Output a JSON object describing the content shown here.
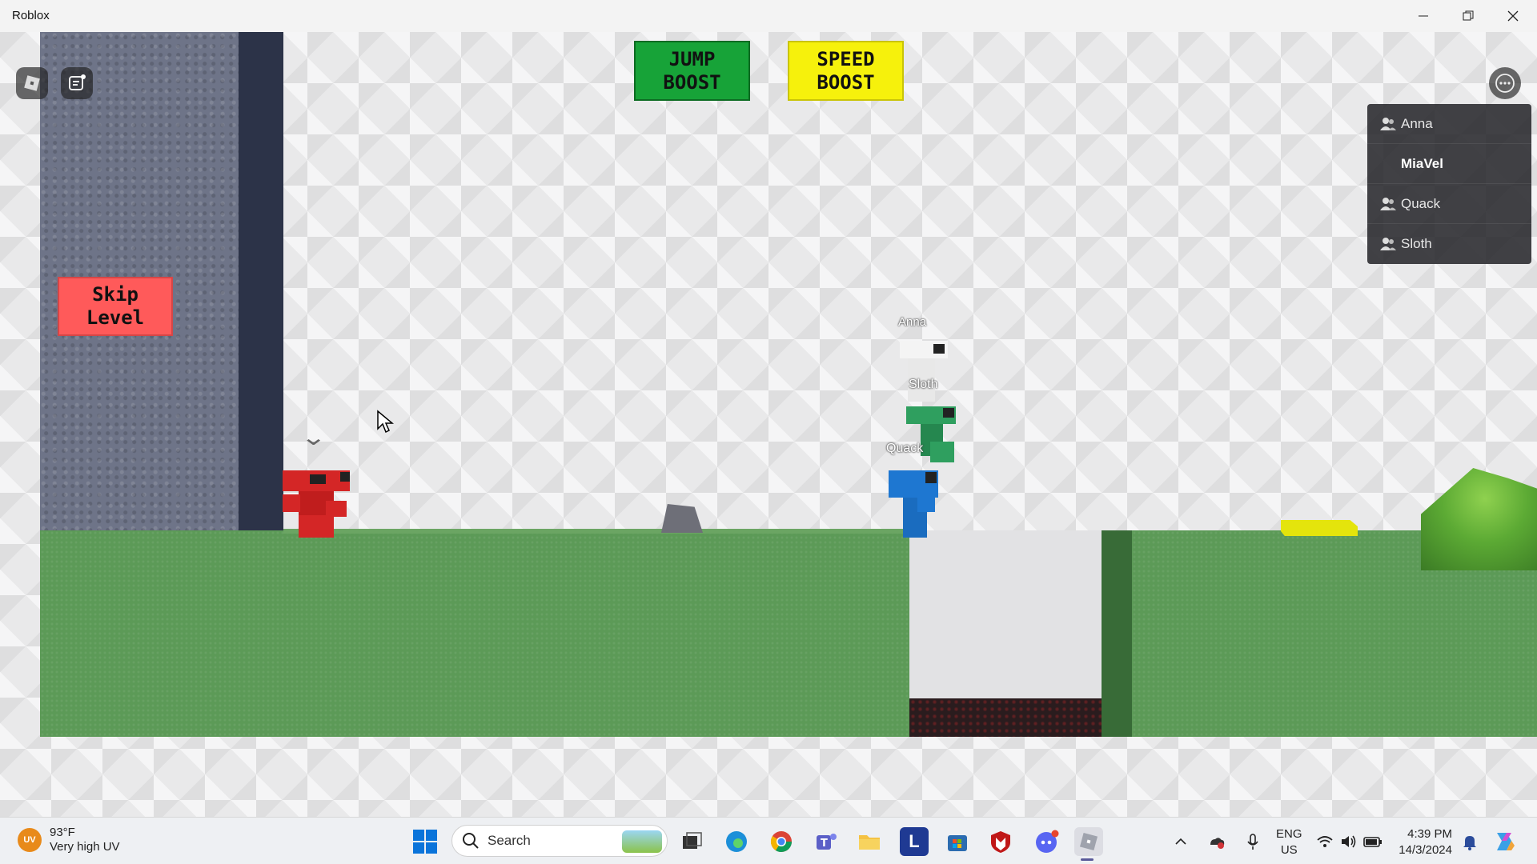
{
  "window": {
    "title": "Roblox"
  },
  "signs": {
    "skip_level": "Skip\nLevel",
    "jump_boost": "JUMP\nBOOST",
    "speed_boost": "SPEED\nBOOST"
  },
  "characters": {
    "anna": "Anna",
    "sloth": "Sloth",
    "quack": "Quack"
  },
  "player_list": [
    {
      "name": "Anna"
    },
    {
      "name": "MiaVel"
    },
    {
      "name": "Quack"
    },
    {
      "name": "Sloth"
    }
  ],
  "taskbar": {
    "weather_temp": "93°F",
    "weather_desc": "Very high UV",
    "uv_badge": "UV",
    "search_placeholder": "Search",
    "language": "ENG",
    "region": "US",
    "time": "4:39 PM",
    "date": "14/3/2024"
  },
  "colors": {
    "jump_boost": "#17a338",
    "speed_boost": "#f6f10c",
    "skip_level": "#ff5a5a",
    "grass": "#5c9a57",
    "red_char": "#d42626",
    "green_char": "#2f9f5f",
    "blue_char": "#1e77d1"
  },
  "icons": [
    "roblox-logo-icon",
    "chat-icon",
    "more-icon",
    "player-icon",
    "windows-start-icon",
    "search-icon",
    "wifi-icon",
    "volume-icon",
    "battery-icon",
    "bell-icon"
  ]
}
